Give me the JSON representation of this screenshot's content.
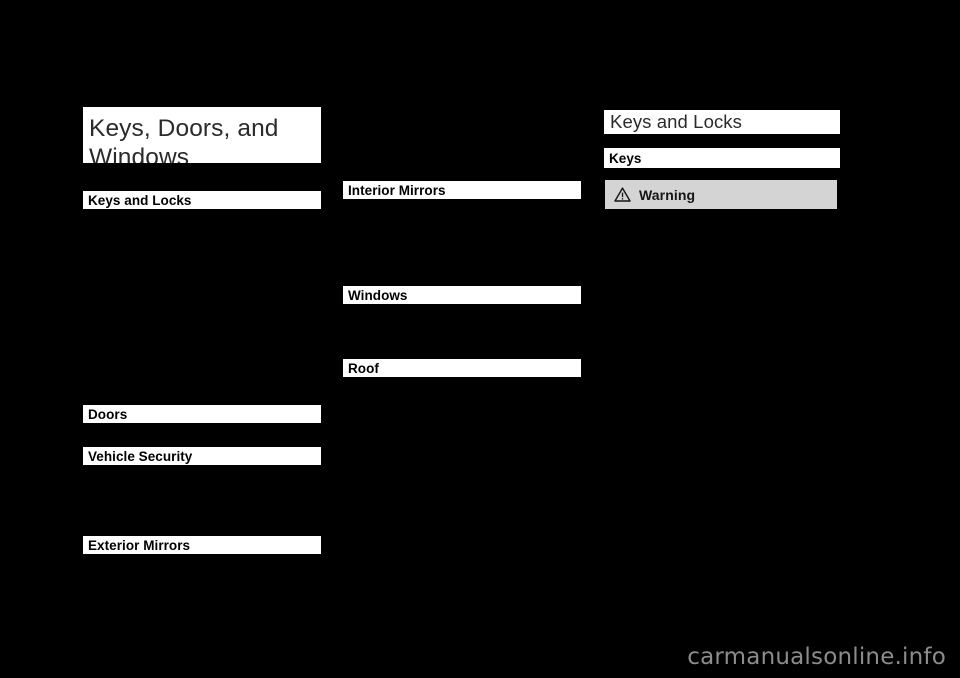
{
  "document": {
    "background_color": "#000000",
    "bar_color": "#ffffff",
    "warning_box_color": "#d4d4d4",
    "watermark_color": "#8c8c8c"
  },
  "columns": {
    "left": {
      "chapter_title": "Keys, Doors, and Windows",
      "entries": [
        {
          "label": "Keys and Locks"
        },
        {
          "label": "Doors"
        },
        {
          "label": "Vehicle Security"
        },
        {
          "label": "Exterior Mirrors"
        }
      ]
    },
    "middle": {
      "entries": [
        {
          "label": "Interior Mirrors"
        },
        {
          "label": "Windows"
        },
        {
          "label": "Roof"
        }
      ]
    },
    "right": {
      "section_title": "Keys and Locks",
      "subsection_title": "Keys",
      "warning": {
        "icon": "warning-triangle-icon",
        "label": "Warning"
      }
    }
  },
  "watermark": {
    "text": "carmanualsonline.info"
  }
}
